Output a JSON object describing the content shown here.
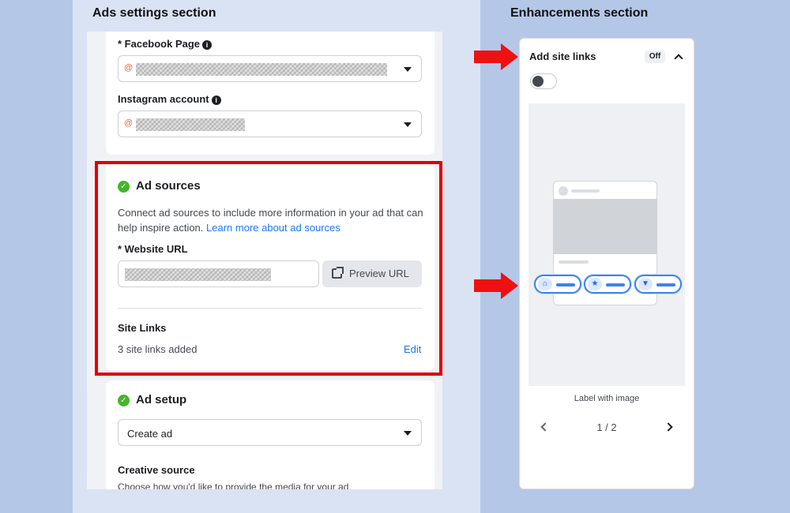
{
  "headings": {
    "left": "Ads settings section",
    "right": "Enhancements section"
  },
  "page_card": {
    "facebook_label": "* Facebook Page",
    "instagram_label": "Instagram account",
    "at_symbol": "@"
  },
  "sources_card": {
    "title": "Ad sources",
    "description": "Connect ad sources to include more information in your ad that can help inspire action.",
    "learn_more": "Learn more about ad sources",
    "website_label": "* Website URL",
    "preview_button": "Preview URL",
    "site_links_title": "Site Links",
    "site_links_count": "3 site links added",
    "edit_link": "Edit"
  },
  "setup_card": {
    "title": "Ad setup",
    "select_value": "Create ad",
    "creative_title": "Creative source",
    "creative_desc": "Choose how you'd like to provide the media for your ad."
  },
  "enhancements": {
    "title": "Add site links",
    "status_badge": "Off",
    "toggle_on": false,
    "caption": "Label with image",
    "pager": "1 / 2"
  },
  "colors": {
    "highlight": "#e00000",
    "accent": "#1877f2",
    "check": "#42b72a"
  },
  "icons": {
    "info": "info-icon",
    "check": "check-circle-icon",
    "dropdown": "caret-down-icon",
    "preview": "external-link-icon",
    "site_link_icons": [
      "store-icon",
      "star-icon",
      "shirt-icon"
    ]
  }
}
